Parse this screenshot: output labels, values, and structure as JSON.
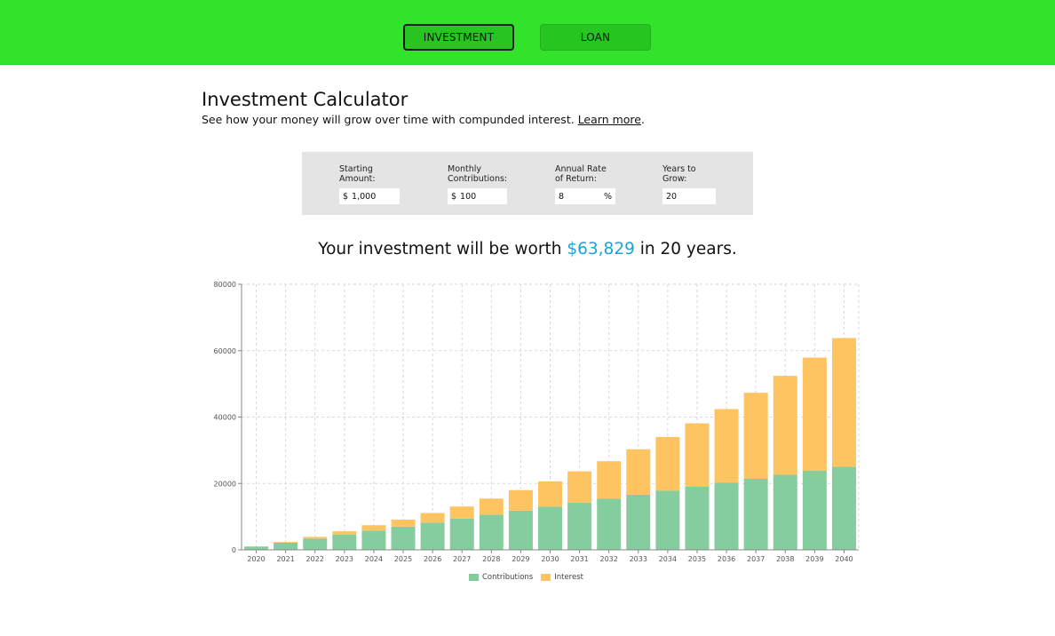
{
  "nav": {
    "tabs": [
      "INVESTMENT",
      "LOAN"
    ]
  },
  "header": {
    "title": "Investment Calculator",
    "subtitle": "See how your money will grow over time with compunded interest.",
    "link": "Learn more",
    "period": "."
  },
  "inputs": {
    "starting": {
      "label1": "Starting",
      "label2": "Amount:",
      "prefix": "$",
      "value": "1,000"
    },
    "monthly": {
      "label1": "Monthly",
      "label2": "Contributions:",
      "prefix": "$",
      "value": "100"
    },
    "rate": {
      "label1": "Annual Rate",
      "label2": "of Return:",
      "value": "8",
      "suffix": "%"
    },
    "years": {
      "label1": "Years to",
      "label2": "Grow:",
      "value": "20"
    }
  },
  "result": {
    "prefix": "Your investment will be worth",
    "amount": "$63,829",
    "suffix": "in 20 years."
  },
  "colors": {
    "contributions": "#85cc9e",
    "interest": "#fec462",
    "accent": "#1aa3d9",
    "nav": "#33e32b"
  },
  "chart_data": {
    "type": "bar",
    "stacked": true,
    "categories": [
      "2020",
      "2021",
      "2022",
      "2023",
      "2024",
      "2025",
      "2026",
      "2027",
      "2028",
      "2029",
      "2030",
      "2031",
      "2032",
      "2033",
      "2034",
      "2035",
      "2036",
      "2037",
      "2038",
      "2039",
      "2040"
    ],
    "series": [
      {
        "name": "Contributions",
        "values": [
          1000,
          2200,
          3400,
          4600,
          5800,
          7000,
          8200,
          9400,
          10600,
          11800,
          13000,
          14200,
          15400,
          16600,
          17800,
          19000,
          20200,
          21400,
          22600,
          23800,
          25000
        ]
      },
      {
        "name": "Interest",
        "values": [
          0,
          180,
          510,
          1000,
          1630,
          2100,
          2900,
          3650,
          4850,
          6200,
          7600,
          9450,
          11300,
          13700,
          16200,
          19100,
          22200,
          25900,
          29800,
          34100,
          38800
        ]
      }
    ],
    "ylim": [
      0,
      80000
    ],
    "yticks": [
      "0",
      "20000",
      "40000",
      "60000",
      "80000"
    ],
    "grid": true,
    "legend": "bottom"
  }
}
